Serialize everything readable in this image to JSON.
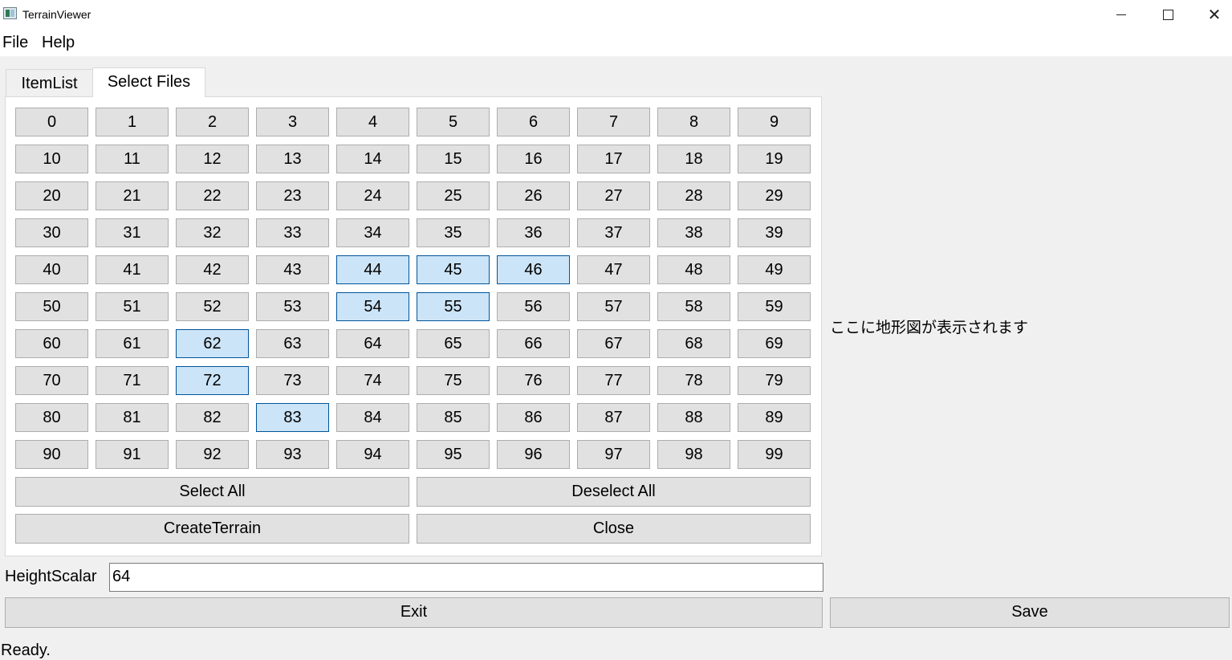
{
  "window": {
    "title": "TerrainViewer",
    "minimize_label": "",
    "maximize_label": "",
    "close_label": "✕"
  },
  "menu": {
    "file": "File",
    "help": "Help"
  },
  "tabs": [
    {
      "label": "ItemList",
      "active": false
    },
    {
      "label": "Select Files",
      "active": true
    }
  ],
  "grid": {
    "cells": [
      "0",
      "1",
      "2",
      "3",
      "4",
      "5",
      "6",
      "7",
      "8",
      "9",
      "10",
      "11",
      "12",
      "13",
      "14",
      "15",
      "16",
      "17",
      "18",
      "19",
      "20",
      "21",
      "22",
      "23",
      "24",
      "25",
      "26",
      "27",
      "28",
      "29",
      "30",
      "31",
      "32",
      "33",
      "34",
      "35",
      "36",
      "37",
      "38",
      "39",
      "40",
      "41",
      "42",
      "43",
      "44",
      "45",
      "46",
      "47",
      "48",
      "49",
      "50",
      "51",
      "52",
      "53",
      "54",
      "55",
      "56",
      "57",
      "58",
      "59",
      "60",
      "61",
      "62",
      "63",
      "64",
      "65",
      "66",
      "67",
      "68",
      "69",
      "70",
      "71",
      "72",
      "73",
      "74",
      "75",
      "76",
      "77",
      "78",
      "79",
      "80",
      "81",
      "82",
      "83",
      "84",
      "85",
      "86",
      "87",
      "88",
      "89",
      "90",
      "91",
      "92",
      "93",
      "94",
      "95",
      "96",
      "97",
      "98",
      "99"
    ],
    "selected": [
      "44",
      "45",
      "46",
      "54",
      "55",
      "62",
      "72",
      "83"
    ],
    "selected_color": "#cce4f7"
  },
  "actions": {
    "select_all": "Select All",
    "deselect_all": "Deselect All",
    "create_terrain": "CreateTerrain",
    "close": "Close"
  },
  "preview": {
    "placeholder": "ここに地形図が表示されます"
  },
  "height_scalar": {
    "label": "HeightScalar",
    "value": "64"
  },
  "footer": {
    "exit": "Exit",
    "save": "Save"
  },
  "status": "Ready."
}
